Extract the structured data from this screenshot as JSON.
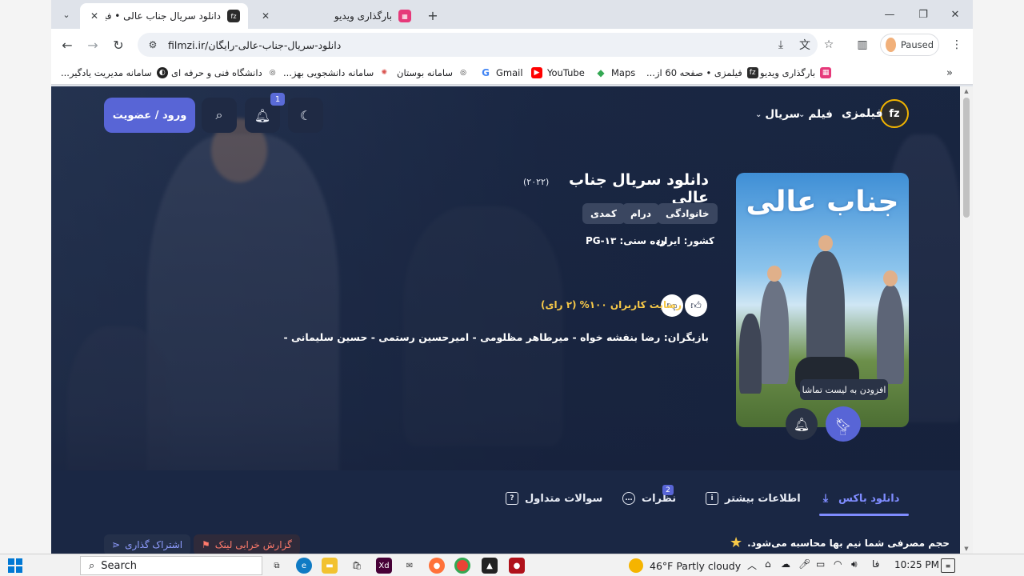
{
  "browser": {
    "tabs": [
      {
        "title": "دانلود سریال جناب عالی • فیلمزی",
        "favicon": "fz",
        "active": true
      },
      {
        "title": "بارگذاری ویدیو",
        "favicon": "video-upload",
        "active": false
      }
    ],
    "url": "filmzi.ir/دانلود-سریال-جناب-عالی-رایگان",
    "profile_label": "Paused",
    "bookmarks": [
      {
        "label": "بارگذاری ویدیو",
        "icon": "video-upload-icon",
        "color": "#e6397a"
      },
      {
        "label": "فیلمزی • صفحه 60 از...",
        "icon": "fz-icon",
        "color": "#2b2b2b"
      },
      {
        "label": "Maps",
        "icon": "maps-icon",
        "color": "#34a853"
      },
      {
        "label": "YouTube",
        "icon": "youtube-icon",
        "color": "#ff0000"
      },
      {
        "label": "Gmail",
        "icon": "google-icon",
        "color": "#4285f4"
      },
      {
        "label": "سامانه بوستان",
        "icon": "university-icon",
        "color": "#333333"
      },
      {
        "label": "سامانه دانشجویی بهز...",
        "icon": "student-portal-icon",
        "color": "#d9534f"
      },
      {
        "label": "دانشگاه فنی و حرفه ای",
        "icon": "university-icon",
        "color": "#333333"
      },
      {
        "label": "سامانه مدیریت یادگیر...",
        "icon": "lms-icon",
        "color": "#222222"
      }
    ]
  },
  "site": {
    "logo_text": "fz",
    "name": "فیلمزی",
    "menu": [
      "فیلم",
      "سریال"
    ],
    "notification_count": "1",
    "login_label": "ورود / عضویت",
    "accent": "#5865d6"
  },
  "movie": {
    "poster_title": "جناب عالی",
    "title": "دانلود سریال جناب عالی",
    "year": "(۲۰۲۲)",
    "genres": [
      "خانوادگی",
      "درام",
      "کمدی"
    ],
    "country": "کشور: ایران",
    "age_rating": "رده سنی: PG-۱۳",
    "rating_text": "رضایت کاربران ۱۰۰% (۲ رای)",
    "cast": "بازیگران: رضا بنفشه خواه - میرطاهر مظلومی - امیرحسین رستمی - حسین سلیمانی -",
    "watchlist_tooltip": "افزودن به لیست تماشا"
  },
  "tabs": {
    "download": "دانلود باکس",
    "more_info": "اطلاعات بیشتر",
    "comments": "نظرات",
    "comments_count": "2",
    "faq": "سوالات متداول"
  },
  "bottom": {
    "notice": "حجم مصرفی شما نیم بها محاسبه می‌شود.",
    "report_label": "گزارش خرابی لینک",
    "share_label": "اشتراک گذاری"
  },
  "taskbar": {
    "search_placeholder": "Search",
    "weather": "46°F  Partly cloudy",
    "language": "فا",
    "time": "10:25 PM"
  }
}
